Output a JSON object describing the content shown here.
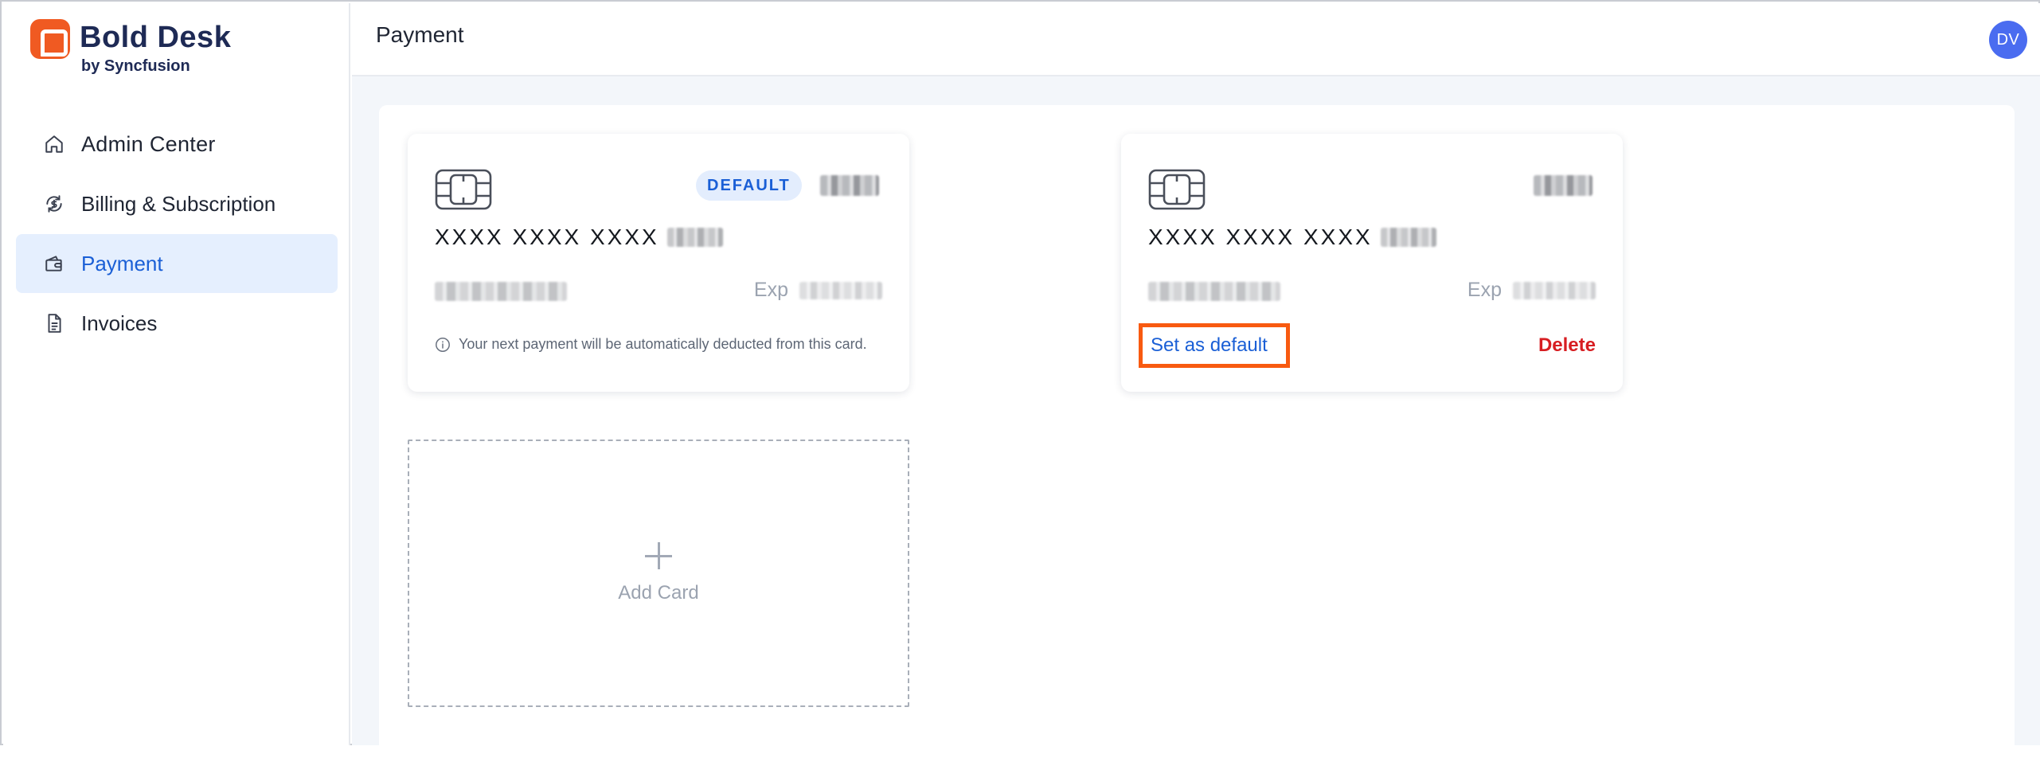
{
  "brand": {
    "name": "Bold Desk",
    "sub": "by Syncfusion"
  },
  "sidebar": {
    "items": [
      {
        "label": "Admin Center",
        "icon": "home-icon"
      },
      {
        "label": "Billing & Subscription",
        "icon": "billing-icon"
      },
      {
        "label": "Payment",
        "icon": "wallet-icon",
        "active": true
      },
      {
        "label": "Invoices",
        "icon": "document-icon"
      }
    ]
  },
  "header": {
    "title": "Payment",
    "avatar": "DV"
  },
  "cards": [
    {
      "badge": "DEFAULT",
      "masked_number": "XXXX XXXX XXXX",
      "exp_label": "Exp",
      "note": "Your next payment will be automatically deducted from this card."
    },
    {
      "masked_number": "XXXX XXXX XXXX",
      "exp_label": "Exp",
      "set_default_label": "Set as default",
      "delete_label": "Delete"
    }
  ],
  "add_card": {
    "label": "Add Card"
  },
  "colors": {
    "accent": "#1a5fd6",
    "brand": "#f05a22",
    "highlight": "#f85a10",
    "danger": "#d71e22"
  }
}
